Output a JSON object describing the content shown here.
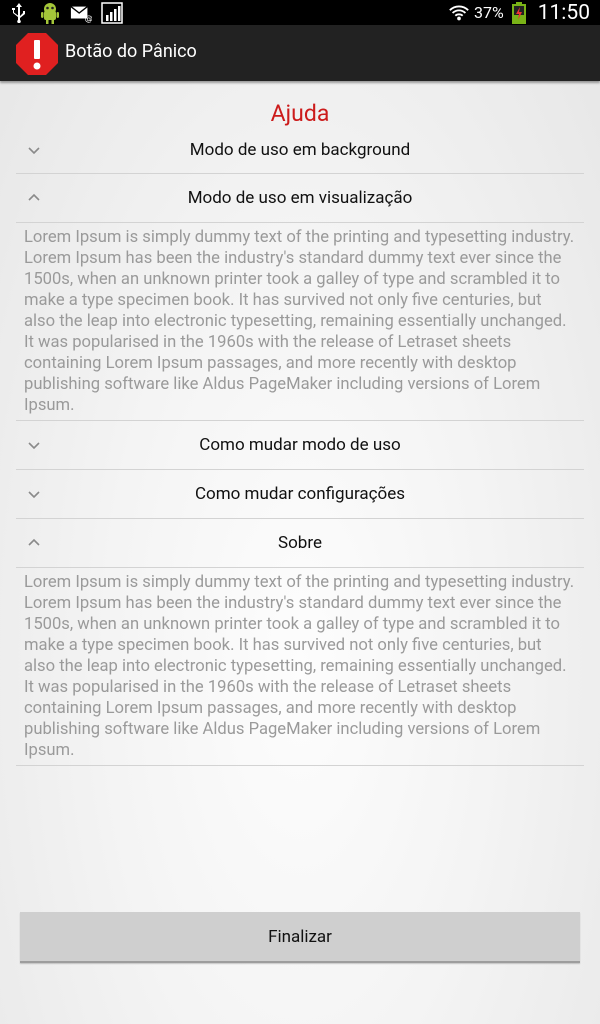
{
  "status_bar": {
    "battery_percent": "37%",
    "time": "11:50",
    "icons_left": [
      "usb-icon",
      "android-icon",
      "mail-icon",
      "signal-icon"
    ],
    "icons_right": [
      "wifi-icon",
      "battery-charging-icon"
    ]
  },
  "action_bar": {
    "title": "Botão do Pânico",
    "icon": "alert-octagon-icon",
    "icon_color": "#e02020"
  },
  "page": {
    "title": "Ajuda",
    "title_color": "#cc1b1b"
  },
  "sections": [
    {
      "title": "Modo de uso em background",
      "expanded": false,
      "body": ""
    },
    {
      "title": "Modo de uso em visualização",
      "expanded": true,
      "body": "Lorem Ipsum is simply dummy text of the printing and typesetting industry. Lorem Ipsum has been the industry's standard dummy text ever since the 1500s, when an unknown printer took a galley of type and scrambled it to make a type specimen book. It has survived not only five centuries, but also the leap into electronic typesetting, remaining essentially unchanged. It was popularised in the 1960s with the release of Letraset sheets containing Lorem Ipsum passages, and more recently with desktop publishing software like Aldus PageMaker including versions of Lorem Ipsum."
    },
    {
      "title": "Como mudar modo de uso",
      "expanded": false,
      "body": ""
    },
    {
      "title": "Como mudar configurações",
      "expanded": false,
      "body": ""
    },
    {
      "title": "Sobre",
      "expanded": true,
      "body": "Lorem Ipsum is simply dummy text of the printing and typesetting industry. Lorem Ipsum has been the industry's standard dummy text ever since the 1500s, when an unknown printer took a galley of type and scrambled it to make a type specimen book. It has survived not only five centuries, but also the leap into electronic typesetting, remaining essentially unchanged. It was popularised in the 1960s with the release of Letraset sheets containing Lorem Ipsum passages, and more recently with desktop publishing software like Aldus PageMaker including versions of Lorem Ipsum."
    }
  ],
  "finish_button": {
    "label": "Finalizar"
  }
}
